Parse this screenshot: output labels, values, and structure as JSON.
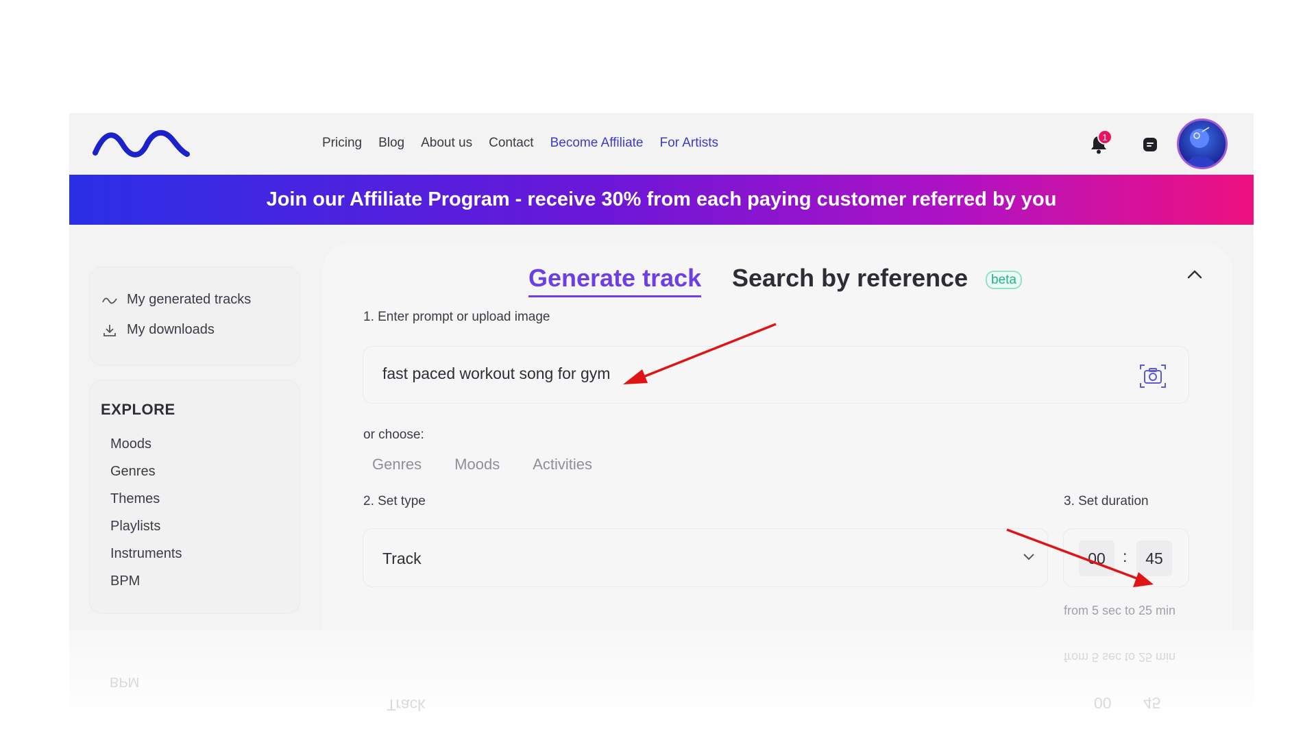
{
  "header": {
    "nav": [
      {
        "label": "Pricing",
        "accent": false
      },
      {
        "label": "Blog",
        "accent": false
      },
      {
        "label": "About us",
        "accent": false
      },
      {
        "label": "Contact",
        "accent": false
      },
      {
        "label": "Become Affiliate",
        "accent": true
      },
      {
        "label": "For Artists",
        "accent": true
      }
    ],
    "notification_count": "1",
    "icons": {
      "logo": "wave-logo",
      "bell": "bell-icon",
      "chat": "chat-icon",
      "avatar": "user-avatar"
    }
  },
  "banner": {
    "text": "Join our Affiliate Program - receive 30% from each paying customer referred by you"
  },
  "sidebar": {
    "links": [
      {
        "label": "My generated tracks",
        "icon": "wave-icon"
      },
      {
        "label": "My downloads",
        "icon": "download-icon"
      }
    ],
    "explore_title": "EXPLORE",
    "explore_items": [
      "Moods",
      "Genres",
      "Themes",
      "Playlists",
      "Instruments",
      "BPM"
    ]
  },
  "main": {
    "tab_generate": "Generate track",
    "tab_search": "Search by reference",
    "beta_badge": "beta",
    "step1_label": "1. Enter prompt or upload image",
    "prompt_value": "fast paced workout song for gym",
    "or_choose": "or choose:",
    "chips": [
      "Genres",
      "Moods",
      "Activities"
    ],
    "step2_label": "2. Set type",
    "type_value": "Track",
    "step3_label": "3. Set duration",
    "duration_min": "00",
    "duration_sec": "45",
    "duration_colon": ":",
    "duration_hint": "from 5 sec to 25 min"
  },
  "colors": {
    "accent": "#6d3ee6",
    "link_blue": "#3b3bc9",
    "banner_start": "#2a2fe6",
    "banner_end": "#ee117f",
    "beta_green": "#23b28a",
    "annotation_red": "#e01414"
  }
}
